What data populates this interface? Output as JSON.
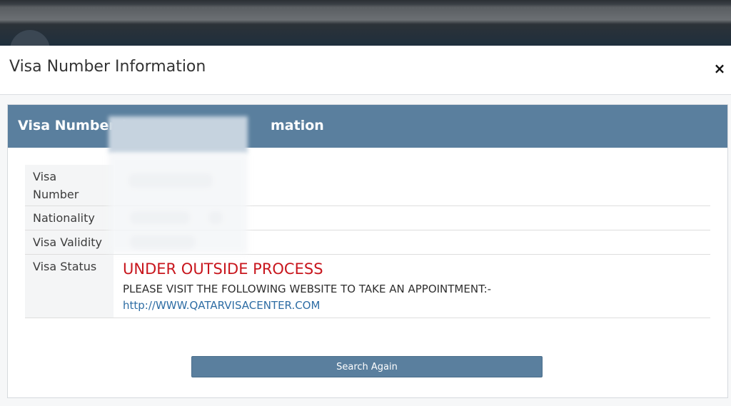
{
  "modal": {
    "title": "Visa Number Information",
    "close_label": "×",
    "panel_heading": "Visa Number (⁣⁣⁣ Information",
    "panel_heading_left": "Visa Number (",
    "panel_heading_right": "mation"
  },
  "fields": [
    {
      "label": "Visa Number"
    },
    {
      "label": "Nationality"
    },
    {
      "label": "Visa Validity"
    },
    {
      "label": "Visa Status"
    }
  ],
  "status": {
    "headline": "UNDER OUTSIDE PROCESS",
    "instruction": "PLEASE VISIT THE FOLLOWING WEBSITE TO TAKE AN APPOINTMENT:-",
    "link": "http://WWW.QATARVISACENTER.COM"
  },
  "actions": {
    "search_again": "Search Again"
  },
  "colors": {
    "panel_header": "#5a7f9e",
    "status_red": "#c8161d",
    "link_blue": "#2e6da4"
  }
}
